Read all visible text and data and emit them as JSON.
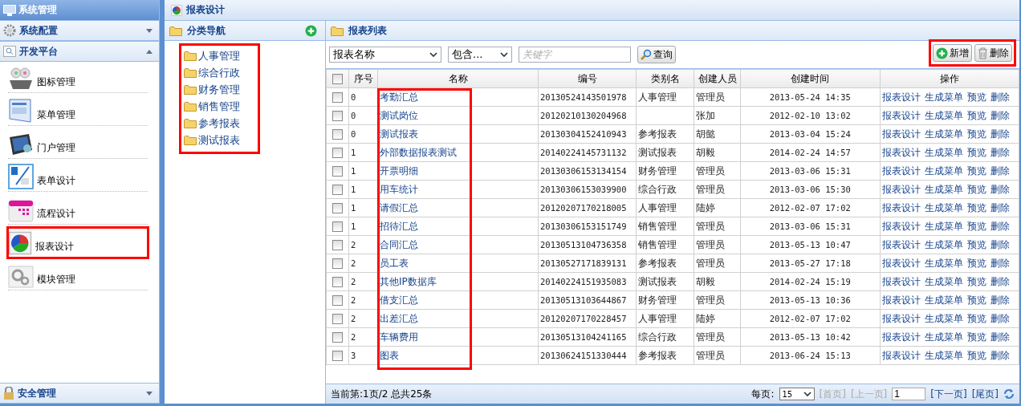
{
  "sidebar": {
    "title": "系统管理",
    "sections": [
      {
        "label": "系统配置",
        "expanded": false
      },
      {
        "label": "开发平台",
        "expanded": true
      }
    ],
    "items": [
      {
        "label": "图标管理",
        "selected": false
      },
      {
        "label": "菜单管理",
        "selected": false
      },
      {
        "label": "门户管理",
        "selected": false
      },
      {
        "label": "表单设计",
        "selected": false
      },
      {
        "label": "流程设计",
        "selected": false
      },
      {
        "label": "报表设计",
        "selected": true
      },
      {
        "label": "模块管理",
        "selected": false
      }
    ],
    "bottom_section": {
      "label": "安全管理",
      "expanded": false
    }
  },
  "main": {
    "title": "报表设计"
  },
  "category_nav": {
    "title": "分类导航",
    "highlighted": true,
    "items": [
      "人事管理",
      "综合行政",
      "财务管理",
      "销售管理",
      "参考报表",
      "测试报表"
    ]
  },
  "report_list": {
    "title": "报表列表",
    "filters": {
      "field": "报表名称",
      "operator": "包含...",
      "keyword_placeholder": "关键字",
      "search_button": "查询"
    },
    "actions": {
      "highlighted": true,
      "add": "新增",
      "delete": "删除"
    },
    "header_checked": false,
    "columns": [
      "序号",
      "名称",
      "编号",
      "类别名",
      "创建人员",
      "创建时间",
      "操作"
    ],
    "name_column_highlighted": true,
    "rows": [
      {
        "checked": false,
        "seq": "0",
        "name": "考勤汇总",
        "code": "20130524143501978",
        "category": "人事管理",
        "creator": "管理员",
        "time": "2013-05-24 14:35",
        "actions": [
          "报表设计",
          "生成菜单",
          "预览",
          "删除"
        ]
      },
      {
        "checked": false,
        "seq": "0",
        "name": "测试岗位",
        "code": "20120210130204968",
        "category": "",
        "creator": "张加",
        "time": "2012-02-10 13:02",
        "actions": [
          "报表设计",
          "生成菜单",
          "预览",
          "删除"
        ]
      },
      {
        "checked": false,
        "seq": "0",
        "name": "测试报表",
        "code": "20130304152410943",
        "category": "参考报表",
        "creator": "胡懿",
        "time": "2013-03-04 15:24",
        "actions": [
          "报表设计",
          "生成菜单",
          "预览",
          "删除"
        ]
      },
      {
        "checked": false,
        "seq": "1",
        "name": "外部数据报表测试",
        "code": "20140224145731132",
        "category": "测试报表",
        "creator": "胡毅",
        "time": "2014-02-24 14:57",
        "actions": [
          "报表设计",
          "生成菜单",
          "预览",
          "删除"
        ]
      },
      {
        "checked": false,
        "seq": "1",
        "name": "开票明细",
        "code": "20130306153134154",
        "category": "财务管理",
        "creator": "管理员",
        "time": "2013-03-06 15:31",
        "actions": [
          "报表设计",
          "生成菜单",
          "预览",
          "删除"
        ]
      },
      {
        "checked": false,
        "seq": "1",
        "name": "用车统计",
        "code": "20130306153039900",
        "category": "综合行政",
        "creator": "管理员",
        "time": "2013-03-06 15:30",
        "actions": [
          "报表设计",
          "生成菜单",
          "预览",
          "删除"
        ]
      },
      {
        "checked": false,
        "seq": "1",
        "name": "请假汇总",
        "code": "20120207170218005",
        "category": "人事管理",
        "creator": "陆婷",
        "time": "2012-02-07 17:02",
        "actions": [
          "报表设计",
          "生成菜单",
          "预览",
          "删除"
        ]
      },
      {
        "checked": false,
        "seq": "1",
        "name": "招待汇总",
        "code": "20130306153151749",
        "category": "销售管理",
        "creator": "管理员",
        "time": "2013-03-06 15:31",
        "actions": [
          "报表设计",
          "生成菜单",
          "预览",
          "删除"
        ]
      },
      {
        "checked": false,
        "seq": "2",
        "name": "合同汇总",
        "code": "20130513104736358",
        "category": "销售管理",
        "creator": "管理员",
        "time": "2013-05-13 10:47",
        "actions": [
          "报表设计",
          "生成菜单",
          "预览",
          "删除"
        ]
      },
      {
        "checked": false,
        "seq": "2",
        "name": "员工表",
        "code": "20130527171839131",
        "category": "参考报表",
        "creator": "管理员",
        "time": "2013-05-27 17:18",
        "actions": [
          "报表设计",
          "生成菜单",
          "预览",
          "删除"
        ]
      },
      {
        "checked": false,
        "seq": "2",
        "name": "其他IP数据库",
        "code": "20140224151935083",
        "category": "测试报表",
        "creator": "胡毅",
        "time": "2014-02-24 15:19",
        "actions": [
          "报表设计",
          "生成菜单",
          "预览",
          "删除"
        ]
      },
      {
        "checked": false,
        "seq": "2",
        "name": "借支汇总",
        "code": "20130513103644867",
        "category": "财务管理",
        "creator": "管理员",
        "time": "2013-05-13 10:36",
        "actions": [
          "报表设计",
          "生成菜单",
          "预览",
          "删除"
        ]
      },
      {
        "checked": false,
        "seq": "2",
        "name": "出差汇总",
        "code": "20120207170228457",
        "category": "人事管理",
        "creator": "陆婷",
        "time": "2012-02-07 17:02",
        "actions": [
          "报表设计",
          "生成菜单",
          "预览",
          "删除"
        ]
      },
      {
        "checked": false,
        "seq": "2",
        "name": "车辆费用",
        "code": "20130513104241165",
        "category": "综合行政",
        "creator": "管理员",
        "time": "2013-05-13 10:42",
        "actions": [
          "报表设计",
          "生成菜单",
          "预览",
          "删除"
        ]
      },
      {
        "checked": false,
        "seq": "3",
        "name": "图表",
        "code": "20130624151330444",
        "category": "参考报表",
        "creator": "管理员",
        "time": "2013-06-24 15:13",
        "actions": [
          "报表设计",
          "生成菜单",
          "预览",
          "删除"
        ]
      }
    ],
    "footer": {
      "status": "当前第:1页/2 总共25条",
      "page_size_label": "每页:",
      "page_size": "15",
      "pager": [
        {
          "label": "[首页]",
          "disabled": true
        },
        {
          "label": "[上一页]",
          "disabled": true
        }
      ],
      "page_input": "1",
      "pager_next": [
        {
          "label": "[下一页]",
          "disabled": false
        },
        {
          "label": "[尾页]",
          "disabled": false
        }
      ]
    }
  }
}
